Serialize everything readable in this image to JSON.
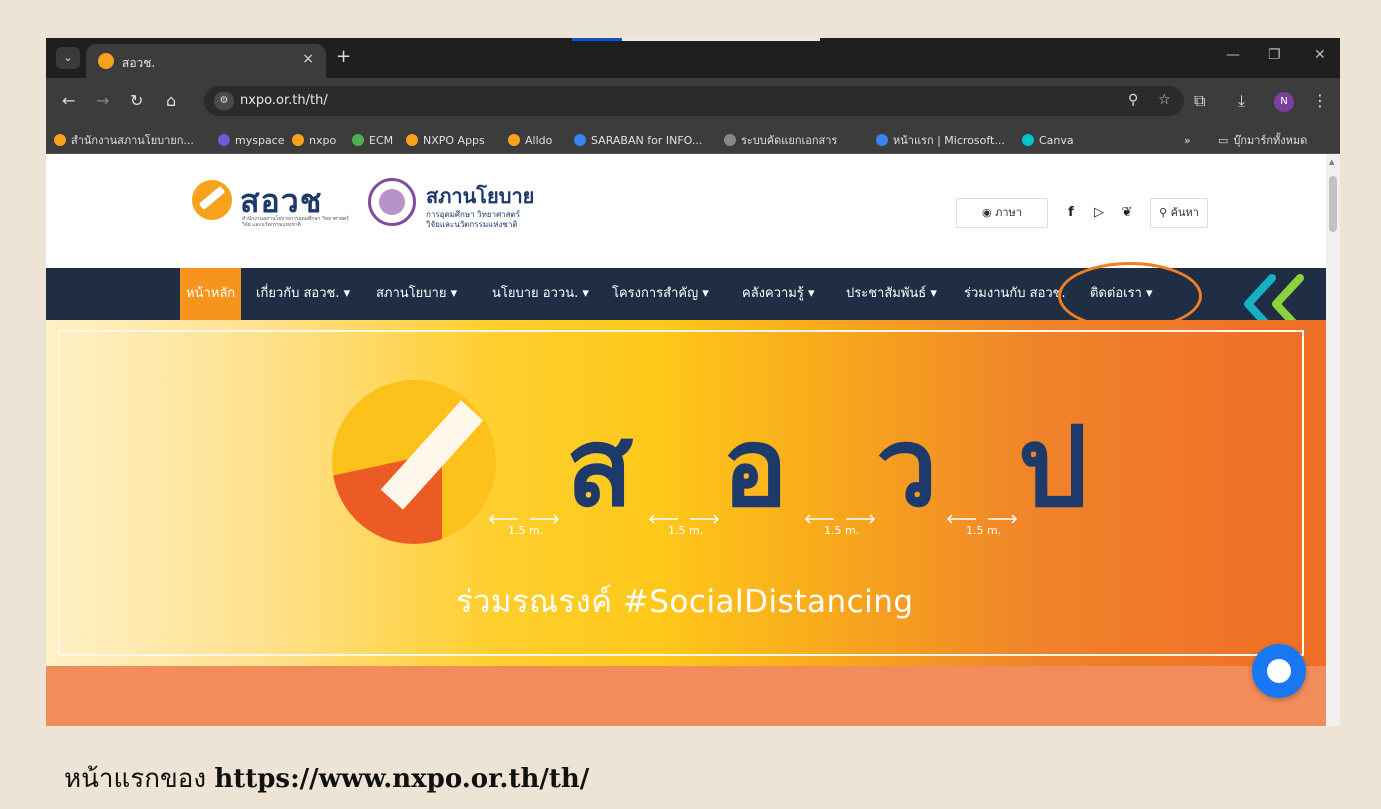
{
  "browser": {
    "tab_title": "สอวช.",
    "new_tab": "+",
    "tab_close": "×",
    "url": "nxpo.or.th/th/",
    "profile_initial": "N",
    "window_controls": [
      "—",
      "❐",
      "✕"
    ]
  },
  "bookmarks": [
    {
      "label": "สำนักงานสภานโยบายก...",
      "color": "#f7a21b"
    },
    {
      "label": "myspace",
      "color": "#6b5bd6"
    },
    {
      "label": "nxpo",
      "color": "#f7a21b"
    },
    {
      "label": "ECM",
      "color": "#4caf50"
    },
    {
      "label": "NXPO Apps",
      "color": "#f7a21b"
    },
    {
      "label": "Alldo",
      "color": "#f7a21b"
    },
    {
      "label": "SARABAN for INFO...",
      "color": "#3b82f6"
    },
    {
      "label": "ระบบคัดแยกเอกสาร",
      "color": "#888888"
    },
    {
      "label": "หน้าแรก | Microsoft...",
      "color": "#3b82f6"
    },
    {
      "label": "Canva",
      "color": "#00c4cc"
    }
  ],
  "bookmarks_more": "»",
  "bookmarks_all": "บุ๊กมาร์กทั้งหมด",
  "site": {
    "logo_text": "สอวช",
    "logo_sub": "สำนักงานสภานโยบายการอุดมศึกษา วิทยาศาสตร์ วิจัย และนวัตกรรมแห่งชาติ",
    "council_title": "สภานโยบาย",
    "council_sub_1": "การอุดมศึกษา วิทยาศาสตร์",
    "council_sub_2": "วิจัยและนวัตกรรมแห่งชาติ",
    "language_label": "ภาษา",
    "search_label": "ค้นหา"
  },
  "nav": [
    "หน้าหลัก",
    "เกี่ยวกับ สอวช. ▾",
    "สภานโยบาย ▾",
    "นโยบาย อววน. ▾",
    "โครงการสำคัญ ▾",
    "คลังความรู้ ▾",
    "ประชาสัมพันธ์ ▾",
    "ร่วมงานกับ สอวช.",
    "ติดต่อเรา ▾"
  ],
  "banner": {
    "letters": [
      "ส",
      "อ",
      "ว",
      "ป"
    ],
    "distance": "1.5 m.",
    "tagline": "ร่วมรณรงค์ #SocialDistancing"
  },
  "caption": {
    "prefix": "หน้าแรกของ ",
    "url": "https://www.nxpo.or.th/th/"
  },
  "colors": {
    "nav_bg": "#1f2e44",
    "accent_orange": "#f7941d",
    "brand_navy": "#1e3a6b",
    "highlight_circle": "#f07f1f"
  }
}
